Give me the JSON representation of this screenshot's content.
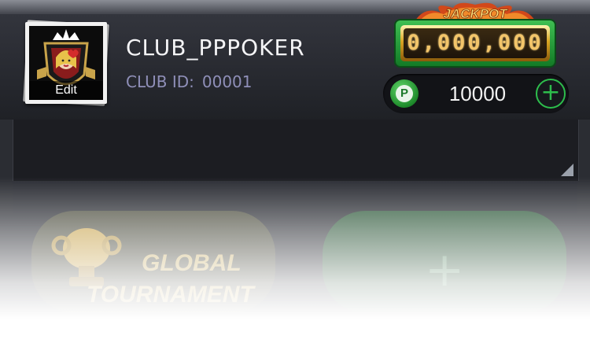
{
  "club": {
    "name": "CLUB_PPPOKER",
    "id_label": "CLUB ID:",
    "id_value": "00001"
  },
  "avatar": {
    "edit_label": "Edit"
  },
  "jackpot": {
    "banner_text": "JACKPOT",
    "value": "0,000,000"
  },
  "points": {
    "coin_letter": "P",
    "value": "10000",
    "add_label": "+"
  },
  "cards": {
    "left": {
      "title_line1": "GLOBAL",
      "title_line2": "TOURNAMENT"
    },
    "right": {
      "plus_label": "+"
    }
  },
  "colors": {
    "accent_green": "#2dbd4c",
    "club_id_text": "#8f8fb8",
    "jackpot_gold": "#f3c56a"
  },
  "icons": [
    "queen-avatar-icon",
    "jackpot-banner-icon",
    "p-coin-icon",
    "add-icon",
    "corner-triangle-icon",
    "trophy-icon",
    "plus-icon"
  ]
}
